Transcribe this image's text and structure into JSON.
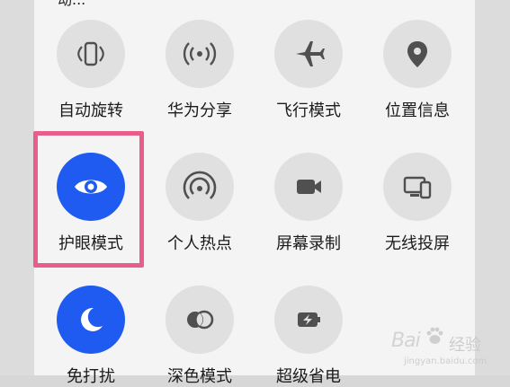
{
  "top_partial_text": "动...",
  "rows": [
    [
      {
        "label": "自动旋转",
        "icon": "rotation-icon",
        "active": false
      },
      {
        "label": "华为分享",
        "icon": "share-wireless-icon",
        "active": false
      },
      {
        "label": "飞行模式",
        "icon": "airplane-icon",
        "active": false
      },
      {
        "label": "位置信息",
        "icon": "location-pin-icon",
        "active": false
      }
    ],
    [
      {
        "label": "护眼模式",
        "icon": "eye-icon",
        "active": true
      },
      {
        "label": "个人热点",
        "icon": "hotspot-icon",
        "active": false
      },
      {
        "label": "屏幕录制",
        "icon": "video-camera-icon",
        "active": false
      },
      {
        "label": "无线投屏",
        "icon": "cast-screen-icon",
        "active": false
      }
    ],
    [
      {
        "label": "免打扰",
        "icon": "moon-icon",
        "active": true
      },
      {
        "label": "深色模式",
        "icon": "dark-mode-icon",
        "active": false
      },
      {
        "label": "超级省电",
        "icon": "battery-saver-icon",
        "active": false
      }
    ]
  ],
  "watermark": {
    "brand": "Bai",
    "text": "经验",
    "url": "jingyan.baidu.com"
  },
  "colors": {
    "accent": "#1f5bf0",
    "highlight": "#e95d8b",
    "tile_bg": "#e0e0e0",
    "panel_bg": "#f4f4f4"
  }
}
